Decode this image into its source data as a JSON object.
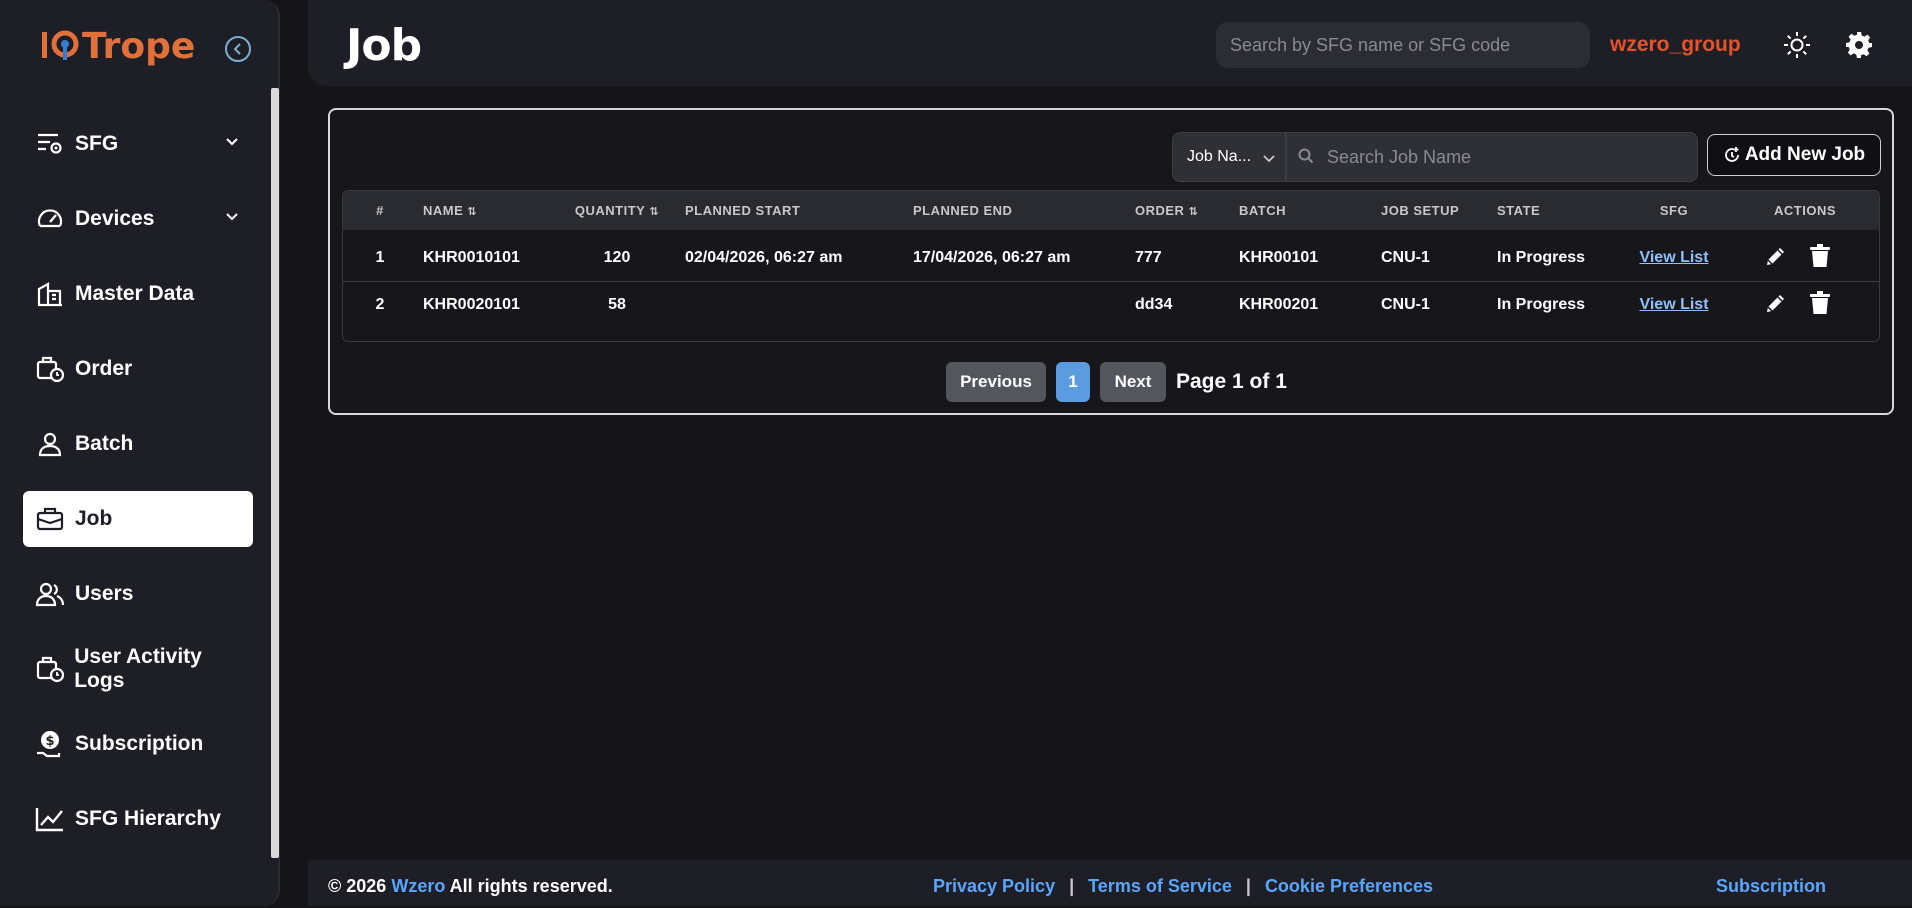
{
  "app": {
    "logo_text": "IoTrope"
  },
  "sidebar": {
    "items": [
      {
        "label": "SFG",
        "icon": "sfg-settings-icon",
        "expandable": true
      },
      {
        "label": "Devices",
        "icon": "gauge-icon",
        "expandable": true
      },
      {
        "label": "Master Data",
        "icon": "building-icon",
        "expandable": false
      },
      {
        "label": "Order",
        "icon": "briefcase-clock-icon",
        "expandable": false
      },
      {
        "label": "Batch",
        "icon": "person-icon",
        "expandable": false
      },
      {
        "label": "Job",
        "icon": "toolbox-icon",
        "expandable": false,
        "active": true
      },
      {
        "label": "Users",
        "icon": "users-icon",
        "expandable": false
      },
      {
        "label": "User Activity Logs",
        "icon": "briefcase-clock-icon",
        "expandable": false
      },
      {
        "label": "Subscription",
        "icon": "coin-hand-icon",
        "expandable": false
      },
      {
        "label": "SFG Hierarchy",
        "icon": "line-chart-icon",
        "expandable": false
      }
    ]
  },
  "header": {
    "title": "Job",
    "search_placeholder": "Search by SFG name or SFG code",
    "user_group": "wzero_group"
  },
  "toolbar": {
    "filter_value": "Job Na...",
    "search_placeholder": "Search Job Name",
    "add_label": "Add New Job"
  },
  "table": {
    "columns": [
      "#",
      "NAME",
      "QUANTITY",
      "PLANNED START",
      "PLANNED END",
      "ORDER",
      "BATCH",
      "JOB SETUP",
      "STATE",
      "SFG",
      "ACTIONS"
    ],
    "sortable": [
      false,
      true,
      true,
      false,
      false,
      true,
      false,
      false,
      false,
      false,
      false
    ],
    "rows": [
      {
        "index": "1",
        "name": "KHR0010101",
        "quantity": "120",
        "planned_start": "02/04/2026, 06:27 am",
        "planned_end": "17/04/2026, 06:27 am",
        "order": "777",
        "batch": "KHR00101",
        "job_setup": "CNU-1",
        "state": "In Progress",
        "sfg": "View List"
      },
      {
        "index": "2",
        "name": "KHR0020101",
        "quantity": "58",
        "planned_start": "",
        "planned_end": "",
        "order": "dd34",
        "batch": "KHR00201",
        "job_setup": "CNU-1",
        "state": "In Progress",
        "sfg": "View List"
      }
    ]
  },
  "pagination": {
    "previous": "Previous",
    "current": "1",
    "next": "Next",
    "info": "Page 1 of 1"
  },
  "footer": {
    "copyright_prefix": "© 2026",
    "brand": "Wzero",
    "copyright_suffix": "All rights reserved.",
    "links": [
      "Privacy Policy",
      "Terms of Service",
      "Cookie Preferences"
    ],
    "subscription": "Subscription"
  },
  "colors": {
    "background": "#141419",
    "panel": "#1e1f26",
    "accent_orange": "#e2703a",
    "user_group": "#e5532d",
    "link_blue": "#5aa6ff",
    "page_active": "#5b9be0"
  }
}
